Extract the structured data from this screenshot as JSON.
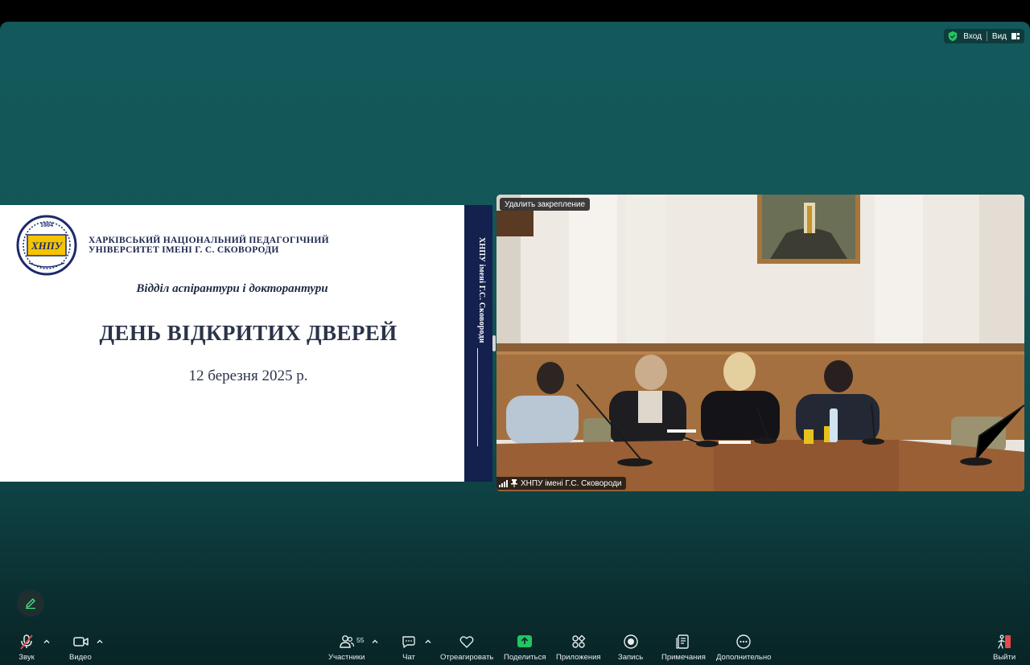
{
  "window": {
    "top_bar": {
      "security_label": "Вход",
      "view_label": "Вид"
    }
  },
  "slide": {
    "logo_year": "1804",
    "logo_text": "ХНПУ",
    "university_line1": "ХАРКІВСЬКИЙ НАЦІОНАЛЬНИЙ ПЕДАГОГІЧНИЙ",
    "university_line2": "УНІВЕРСИТЕТ ІМЕНІ Г. С. СКОВОРОДИ",
    "department": "Відділ аспірантури і докторантури",
    "headline": "ДЕНЬ ВІДКРИТИХ ДВЕРЕЙ",
    "date": "12 березня 2025 р.",
    "band_text": "ХНПУ імені Г.С. Сковороди"
  },
  "video": {
    "unpin_label": "Удалить закрепление",
    "participant_name": "ХНПУ імені Г.С. Сковороди"
  },
  "toolbar": {
    "audio_label": "Звук",
    "video_label": "Видео",
    "participants_label": "Участники",
    "participants_count": "55",
    "chat_label": "Чат",
    "react_label": "Отреагировать",
    "share_label": "Поделиться",
    "apps_label": "Приложения",
    "record_label": "Запись",
    "notes_label": "Примечания",
    "more_label": "Дополнительно",
    "leave_label": "Выйти"
  },
  "colors": {
    "background": "#13585a",
    "share_green": "#22c55e",
    "leave_red": "#e5484d",
    "slide_band": "#14204e"
  }
}
